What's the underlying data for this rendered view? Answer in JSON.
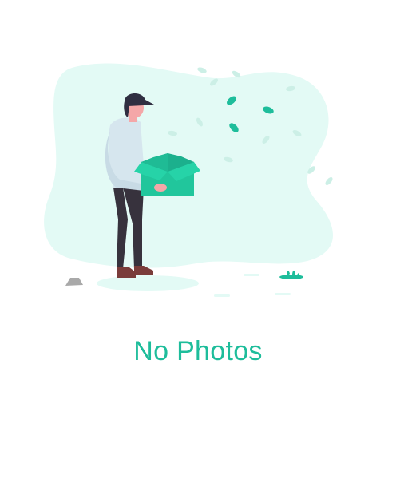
{
  "empty_state": {
    "title": "No Photos",
    "illustration_icon": "empty-box-illustration"
  },
  "colors": {
    "accent": "#1ebd9b",
    "blob": "#e3faf5",
    "leaf_light": "#d4f3ec",
    "box": "#21c69c",
    "box_dark": "#18a684",
    "shirt": "#d6e6ee",
    "pants": "#37323d",
    "shoes": "#7a3c3a",
    "skin": "#f4a7a8",
    "hair_cap": "#2f2e41",
    "rock": "#a9a9a9"
  }
}
